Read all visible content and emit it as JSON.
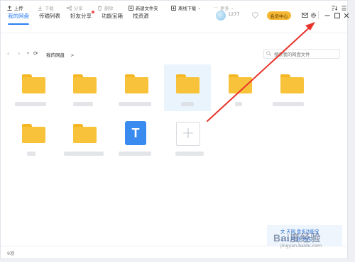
{
  "nav": {
    "tabs": [
      {
        "label": "我的网盘",
        "active": true
      },
      {
        "label": "传输列表"
      },
      {
        "label": "好友分享",
        "badge": true
      },
      {
        "label": "功能宝箱"
      },
      {
        "label": "找资源"
      }
    ]
  },
  "user": {
    "name": "1277",
    "vip_label": "会员中心"
  },
  "toolbar": {
    "upload": "上传",
    "download": "下载",
    "share": "分享",
    "delete": "删除",
    "new_folder": "新建文件夹",
    "offline": "离线下载",
    "more": "更多"
  },
  "address": {
    "breadcrumb": "我的网盘",
    "chevron": ">",
    "search_placeholder": "搜索我的网盘文件"
  },
  "files": [
    {
      "kind": "folder"
    },
    {
      "kind": "folder"
    },
    {
      "kind": "folder"
    },
    {
      "kind": "folder",
      "selected": true
    },
    {
      "kind": "folder"
    },
    {
      "kind": "folder"
    },
    {
      "kind": "folder"
    },
    {
      "kind": "folder"
    },
    {
      "kind": "doc",
      "glyph": "T"
    },
    {
      "kind": "add",
      "glyph": "+"
    }
  ],
  "status": {
    "count": "9项"
  },
  "watermark": {
    "line1": "文 天网 盘多功能宝",
    "line2": "1 (1 可 转 号在",
    "logo": "Bai度经验",
    "url": "jingyan.baidu.com"
  },
  "colors": {
    "accent": "#2b7df5",
    "folder": "#f8c33a",
    "arrow": "#e8332a",
    "vip": "#f5b733"
  }
}
